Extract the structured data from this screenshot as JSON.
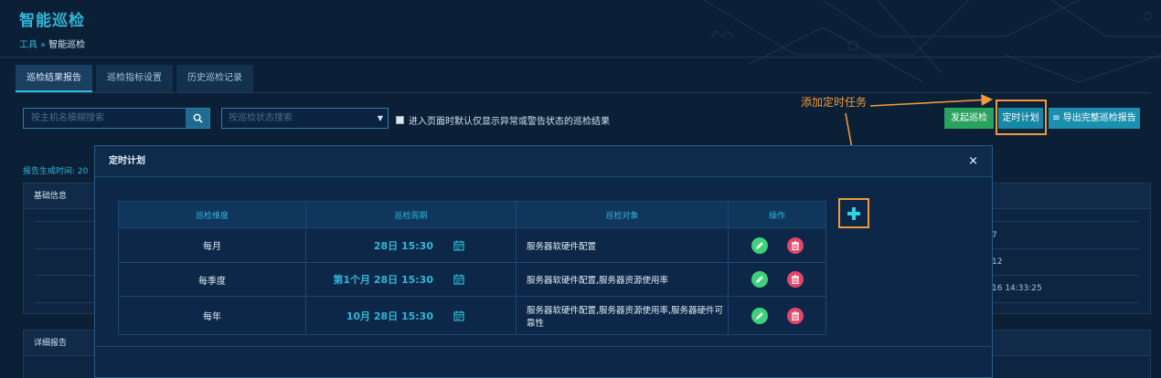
{
  "page": {
    "title": "智能巡检",
    "breadcrumb": {
      "parent": "工具",
      "separator": "»",
      "current": "智能巡检"
    }
  },
  "tabs": [
    {
      "label": "巡检结果报告",
      "active": true
    },
    {
      "label": "巡检指标设置",
      "active": false
    },
    {
      "label": "历史巡检记录",
      "active": false
    }
  ],
  "filters": {
    "search_placeholder": "按主机名模糊搜索",
    "status_placeholder": "按巡检状态搜索",
    "checkbox_label": "进入页面时默认仅显示异常或警告状态的巡检结果",
    "checkbox_checked": false
  },
  "toolbar": {
    "start_label": "发起巡检",
    "schedule_label": "定时计划",
    "export_label": "导出完整巡检报告",
    "export_icon": "≡"
  },
  "annotation": {
    "text": "添加定时任务",
    "color": "#f09a3a"
  },
  "background": {
    "report_time_label": "报告生成时间: 20",
    "basic_info_title": "基础信息",
    "basic_values": [
      "7",
      "12",
      "16 14:33:25"
    ],
    "detail_title": "详细报告"
  },
  "modal": {
    "title": "定时计划",
    "close_symbol": "×",
    "columns": [
      "巡检维度",
      "巡检周期",
      "巡检对象",
      "操作"
    ],
    "rows": [
      {
        "dimension": "每月",
        "period": "28日 15:30",
        "object": "服务器软硬件配置"
      },
      {
        "dimension": "每季度",
        "period": "第1个月 28日 15:30",
        "object": "服务器软硬件配置,服务器资源使用率"
      },
      {
        "dimension": "每年",
        "period": "10月 28日 15:30",
        "object": "服务器软硬件配置,服务器资源使用率,服务器硬件可靠性"
      }
    ],
    "add_symbol": "+"
  },
  "colors": {
    "accent": "#2fb7d8",
    "green": "#2aa35f",
    "teal": "#1687a6",
    "edit": "#3fd07a",
    "delete": "#e4466a",
    "annotation": "#f09a3a"
  }
}
